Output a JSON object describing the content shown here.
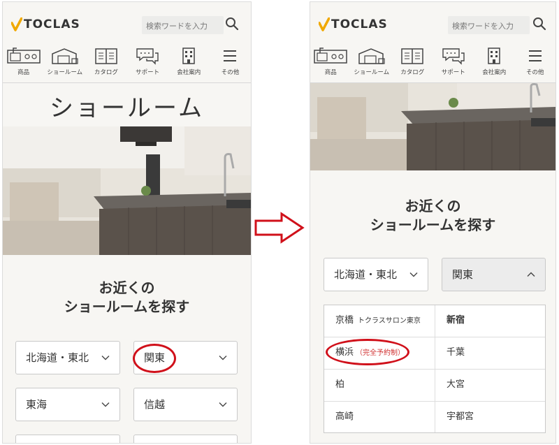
{
  "header": {
    "logo_text": "TOCLAS",
    "search_placeholder": "検索ワードを入力"
  },
  "nav": [
    {
      "label": "商品",
      "icon": "products-icon"
    },
    {
      "label": "ショールーム",
      "icon": "showroom-icon"
    },
    {
      "label": "カタログ",
      "icon": "catalog-icon"
    },
    {
      "label": "サポート",
      "icon": "support-icon"
    },
    {
      "label": "会社案内",
      "icon": "company-icon"
    },
    {
      "label": "その他",
      "icon": "menu-icon"
    }
  ],
  "left": {
    "page_title": "ショールーム",
    "section_title_line1": "お近くの",
    "section_title_line2": "ショールームを探す",
    "regions": [
      "北海道・東北",
      "関東",
      "東海",
      "信越"
    ]
  },
  "right": {
    "section_title_line1": "お近くの",
    "section_title_line2": "ショールームを探す",
    "region_1": "北海道・東北",
    "region_2_open": "関東",
    "showrooms": [
      {
        "name": "京橋",
        "note": "トクラスサロン東京"
      },
      {
        "name": "新宿",
        "note": ""
      },
      {
        "name": "横浜",
        "note": "（完全予約制）"
      },
      {
        "name": "千葉",
        "note": ""
      },
      {
        "name": "柏",
        "note": ""
      },
      {
        "name": "大宮",
        "note": ""
      },
      {
        "name": "高崎",
        "note": ""
      },
      {
        "name": "宇都宮",
        "note": ""
      }
    ]
  },
  "colors": {
    "logo_check": "#f0a800",
    "highlight_ring": "#d0101a",
    "reservation_red": "#d03030",
    "background": "#f7f6f3"
  }
}
